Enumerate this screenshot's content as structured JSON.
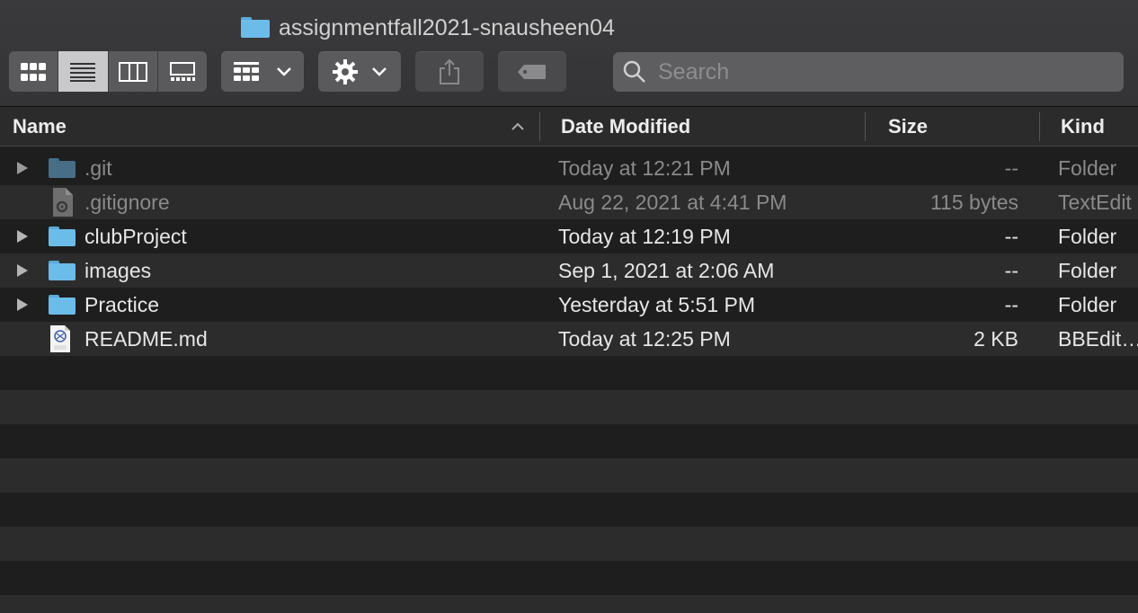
{
  "window": {
    "title": "assignmentfall2021-snausheen04"
  },
  "toolbar": {
    "view_modes": [
      {
        "icon": "icon-view-icon",
        "active": false
      },
      {
        "icon": "list-view-icon",
        "active": true
      },
      {
        "icon": "column-view-icon",
        "active": false
      },
      {
        "icon": "gallery-view-icon",
        "active": false
      }
    ],
    "group_button_icon": "group-icon",
    "action_button_icon": "gear-icon",
    "share_button_icon": "share-icon",
    "tag_button_icon": "tag-icon",
    "search": {
      "placeholder": "Search",
      "value": ""
    }
  },
  "columns": {
    "name": "Name",
    "date_modified": "Date Modified",
    "size": "Size",
    "kind": "Kind"
  },
  "files": [
    {
      "name": ".git",
      "date": "Today at 12:21 PM",
      "size": "--",
      "kind": "Folder",
      "type": "folder",
      "hidden": true,
      "expandable": true
    },
    {
      "name": ".gitignore",
      "date": "Aug 22, 2021 at 4:41 PM",
      "size": "115 bytes",
      "kind": "TextEdit",
      "type": "text-file",
      "hidden": true,
      "expandable": false
    },
    {
      "name": "clubProject",
      "date": "Today at 12:19 PM",
      "size": "--",
      "kind": "Folder",
      "type": "folder",
      "hidden": false,
      "expandable": true
    },
    {
      "name": "images",
      "date": "Sep 1, 2021 at 2:06 AM",
      "size": "--",
      "kind": "Folder",
      "type": "folder",
      "hidden": false,
      "expandable": true
    },
    {
      "name": "Practice",
      "date": "Yesterday at 5:51 PM",
      "size": "--",
      "kind": "Folder",
      "type": "folder",
      "hidden": false,
      "expandable": true
    },
    {
      "name": "README.md",
      "date": "Today at 12:25 PM",
      "size": "2 KB",
      "kind": "BBEdit…",
      "type": "text-document",
      "hidden": false,
      "expandable": false
    }
  ],
  "colors": {
    "folder": "#6cbcea",
    "background": "#1e1e1e",
    "stripe": "#2c2c2c"
  }
}
